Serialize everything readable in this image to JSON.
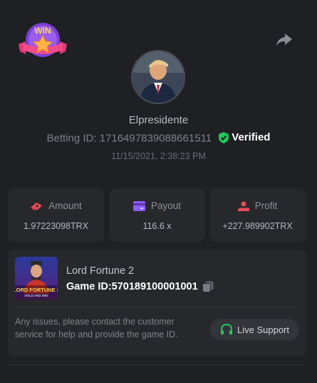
{
  "header": {
    "badge_text": "WIN",
    "share_icon": "share-arrow-icon"
  },
  "user": {
    "avatar_icon": "user-avatar",
    "username": "Elpresidente",
    "betting_id_label": "Betting ID:",
    "betting_id": "1716497839088661511",
    "verified_label": "Verified",
    "verified_color": "#22c55e",
    "timestamp": "11/15/2021, 2:38:23 PM"
  },
  "stats": [
    {
      "label": "Amount",
      "value": "1.97223098TRX",
      "icon": "money-icon",
      "color": "#e84c5a"
    },
    {
      "label": "Payout",
      "value": "116.6 x",
      "icon": "card-icon",
      "color": "#8b5cf6"
    },
    {
      "label": "Profit",
      "value": "+227.989902TRX",
      "icon": "coin-hand-icon",
      "color": "#e84c5a"
    }
  ],
  "game": {
    "thumbnail_title": "LORD FORTUNE 2",
    "thumbnail_subtitle": "HOLD AND WIN",
    "name": "Lord Fortune 2",
    "id_label": "Game ID:",
    "id": "570189100001001",
    "support_message": "Any issues, please contact the customer service for help and provide the game ID.",
    "support_button": "Live Support",
    "support_icon_color": "#22c55e"
  },
  "colors": {
    "background": "#1f2023",
    "card": "#27282c",
    "accent_green": "#22c55e"
  }
}
